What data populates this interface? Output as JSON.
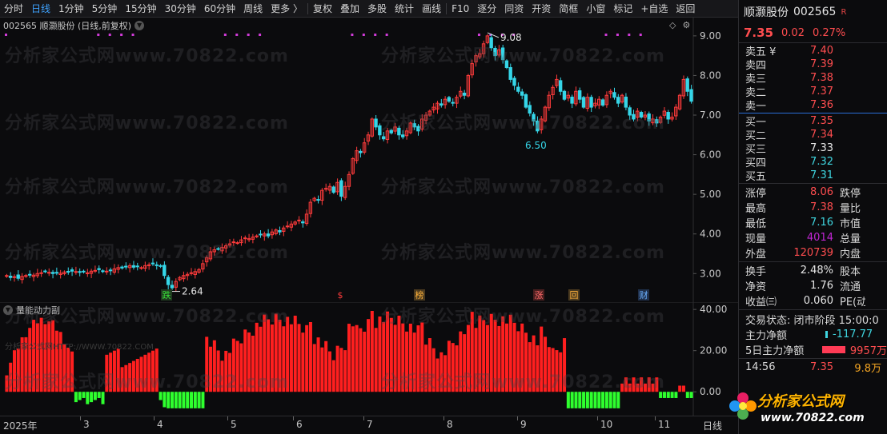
{
  "toolbar": {
    "items": [
      "分时",
      "日线",
      "1分钟",
      "5分钟",
      "15分钟",
      "30分钟",
      "60分钟",
      "周线",
      "更多 〉",
      "复权",
      "叠加",
      "多股",
      "统计",
      "画线",
      "F10",
      "逐分",
      "同资",
      "开资",
      "简框",
      "小窗",
      "标记",
      "+自选",
      "返回"
    ],
    "active_index": 1
  },
  "chart": {
    "title": "002565 顺灏股份 (日线,前复权)",
    "dropdown_icon": "chevron-down-icon",
    "high_label": "9.08",
    "low_label": "2.64",
    "pivot_label": "6.50",
    "events": [
      "跌",
      "$",
      "榜",
      "涨",
      "回",
      "财"
    ],
    "watermark": "分析家公式网www.70822.com",
    "y_ticks": [
      "9.00",
      "8.00",
      "7.00",
      "6.00",
      "5.00",
      "4.00",
      "3.00"
    ]
  },
  "indicator": {
    "title": "量能动力副",
    "watermark": "分析家公式网HTTP://WWW.70822.COM",
    "y_ticks": [
      "40.00",
      "20.00",
      "0.00"
    ]
  },
  "xaxis": {
    "labels": [
      "2025年",
      "3",
      "4",
      "5",
      "6",
      "7",
      "8",
      "9",
      "10",
      "11",
      "日线"
    ]
  },
  "panel": {
    "name": "顺灏股份",
    "code": "002565",
    "badge": "R",
    "price": "7.35",
    "change": "0.02",
    "change_pct": "0.27%",
    "asks": [
      {
        "label": "卖五 ¥",
        "price": "7.40"
      },
      {
        "label": "卖四",
        "price": "7.39"
      },
      {
        "label": "卖三",
        "price": "7.38"
      },
      {
        "label": "卖二",
        "price": "7.37"
      },
      {
        "label": "卖一",
        "price": "7.36"
      }
    ],
    "bids": [
      {
        "label": "买一",
        "price": "7.35",
        "color": "#ff4d4f"
      },
      {
        "label": "买二",
        "price": "7.34",
        "color": "#ff4d4f"
      },
      {
        "label": "买三",
        "price": "7.33",
        "color": "#e6e6e6"
      },
      {
        "label": "买四",
        "price": "7.32",
        "color": "#3fd6e0"
      },
      {
        "label": "买五",
        "price": "7.31",
        "color": "#3fd6e0"
      }
    ],
    "stats": [
      {
        "k": "涨停",
        "v": "8.06",
        "c": "red",
        "k2": "跌停"
      },
      {
        "k": "最高",
        "v": "7.38",
        "c": "red",
        "k2": "量比"
      },
      {
        "k": "最低",
        "v": "7.16",
        "c": "cyan",
        "k2": "市值"
      },
      {
        "k": "现量",
        "v": "4014",
        "c": "mag",
        "k2": "总量"
      },
      {
        "k": "外盘",
        "v": "120739",
        "c": "red",
        "k2": "内盘"
      }
    ],
    "stats2": [
      {
        "k": "换手",
        "v": "2.48%",
        "c": "white",
        "k2": "股本"
      },
      {
        "k": "净资",
        "v": "1.76",
        "c": "white",
        "k2": "流通"
      },
      {
        "k": "收益㈢",
        "v": "0.060",
        "c": "white",
        "k2": "PE(动)"
      }
    ],
    "tx_status": "交易状态: 闭市阶段 15:00:0",
    "flows": [
      {
        "k": "主力净额",
        "v": "-117.77",
        "c": "cyan"
      },
      {
        "k": "5日主力净额",
        "v": "9957万",
        "c": "red"
      }
    ],
    "tick": {
      "time": "14:56",
      "price": "7.35",
      "vol": "9.8万"
    }
  },
  "logo": {
    "line1": "分析家公式网",
    "line2": "www.70822.com"
  },
  "chart_data": {
    "type": "candlestick",
    "title": "002565 顺灏股份 (日线,前复权)",
    "ylim": [
      2.4,
      9.3
    ],
    "y_ticks": [
      3,
      4,
      5,
      6,
      7,
      8,
      9
    ],
    "x_month_labels": [
      "2025年",
      "3",
      "4",
      "5",
      "6",
      "7",
      "8",
      "9",
      "10",
      "11"
    ],
    "close_path": [
      2.95,
      2.9,
      2.92,
      2.88,
      2.93,
      2.95,
      2.97,
      2.96,
      3.0,
      3.02,
      3.05,
      3.03,
      3.0,
      3.02,
      3.01,
      3.04,
      3.05,
      3.06,
      3.05,
      3.03,
      3.04,
      3.02,
      3.06,
      3.08,
      3.1,
      3.05,
      3.06,
      3.08,
      3.12,
      3.15,
      3.14,
      3.18,
      3.2,
      3.16,
      3.18,
      3.15,
      3.2,
      3.22,
      3.25,
      3.2,
      3.18,
      2.95,
      2.72,
      2.64,
      2.8,
      2.9,
      2.95,
      2.98,
      3.02,
      3.05,
      3.1,
      3.25,
      3.4,
      3.55,
      3.6,
      3.62,
      3.66,
      3.7,
      3.75,
      3.8,
      3.78,
      3.85,
      3.9,
      3.88,
      3.92,
      3.95,
      3.98,
      4.0,
      3.95,
      4.05,
      4.1,
      4.05,
      4.15,
      4.2,
      4.25,
      4.3,
      4.35,
      4.28,
      4.5,
      4.8,
      4.9,
      4.85,
      5.1,
      5.15,
      5.2,
      5.05,
      5.3,
      4.95,
      5.2,
      5.5,
      5.9,
      6.1,
      6.05,
      6.3,
      6.5,
      6.9,
      6.7,
      6.5,
      6.4,
      6.6,
      6.55,
      6.7,
      6.5,
      6.45,
      6.6,
      6.8,
      6.7,
      6.6,
      6.9,
      7.0,
      7.1,
      7.2,
      7.3,
      7.25,
      7.4,
      7.35,
      7.3,
      7.45,
      7.6,
      7.5,
      8.0,
      8.3,
      8.5,
      8.55,
      8.8,
      9.0,
      8.7,
      8.5,
      8.65,
      8.4,
      8.2,
      7.9,
      7.75,
      7.6,
      7.5,
      7.2,
      7.05,
      6.85,
      6.6,
      6.9,
      7.2,
      7.5,
      7.7,
      7.9,
      7.6,
      7.4,
      7.5,
      7.3,
      7.6,
      7.4,
      7.2,
      7.45,
      7.2,
      7.3,
      7.4,
      7.25,
      7.5,
      7.6,
      7.45,
      7.3,
      7.5,
      7.2,
      7.0,
      6.9,
      7.1,
      6.95,
      7.0,
      6.85,
      6.9,
      6.8,
      6.95,
      7.1,
      6.9,
      6.95,
      7.2,
      7.5,
      7.9,
      7.6,
      7.35
    ],
    "indicator": {
      "name": "量能动力副",
      "ylim": [
        -10,
        42
      ],
      "y_ticks": [
        40,
        20,
        0
      ]
    }
  }
}
